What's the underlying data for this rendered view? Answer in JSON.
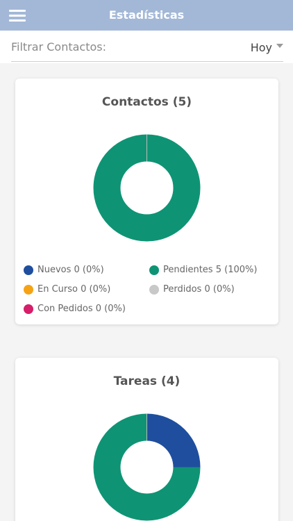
{
  "header": {
    "title": "Estadísticas",
    "menu_icon": "hamburger-menu-icon"
  },
  "filter": {
    "label": "Filtrar Contactos:",
    "selected": "Hoy",
    "dropdown_icon": "caret-down-icon"
  },
  "contacts": {
    "title": "Contactos (5)",
    "slices": [
      {
        "key": "nuevos",
        "value": 0,
        "color": "#1f4e9e"
      },
      {
        "key": "pendientes",
        "value": 5,
        "color": "#0e9474"
      },
      {
        "key": "en_curso",
        "value": 0,
        "color": "#f5a315"
      },
      {
        "key": "perdidos",
        "value": 0,
        "color": "#c8c8c8"
      },
      {
        "key": "con_pedidos",
        "value": 0,
        "color": "#d61e6a"
      }
    ],
    "legend": [
      {
        "key": "nuevos",
        "label": "Nuevos 0 (0%)",
        "color": "#1f4e9e"
      },
      {
        "key": "pendientes",
        "label": "Pendientes 5 (100%)",
        "color": "#0e9474"
      },
      {
        "key": "en_curso",
        "label": "En Curso 0 (0%)",
        "color": "#f5a315"
      },
      {
        "key": "perdidos",
        "label": "Perdidos 0 (0%)",
        "color": "#c8c8c8"
      },
      {
        "key": "con_pedidos",
        "label": "Con Pedidos 0 (0%)",
        "color": "#d61e6a"
      }
    ]
  },
  "tasks": {
    "title": "Tareas (4)",
    "slices": [
      {
        "value": 1,
        "color": "#1f4e9e"
      },
      {
        "value": 3,
        "color": "#0e9474"
      }
    ]
  }
}
